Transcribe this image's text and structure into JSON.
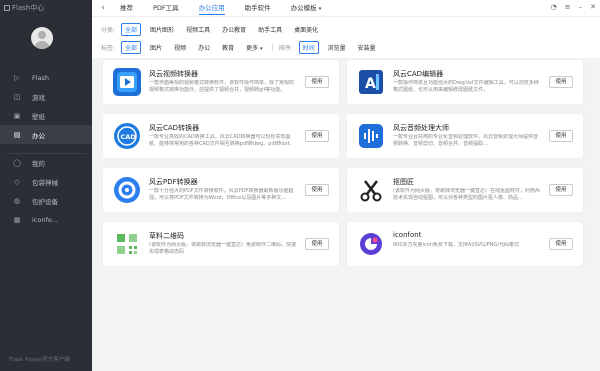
{
  "app": {
    "logo_text": "Flash中心",
    "footer": "Flash Player官方客户端"
  },
  "sidebar": {
    "items": [
      {
        "label": "Flash",
        "icon": "play-icon"
      },
      {
        "label": "游戏",
        "icon": "gamepad-icon"
      },
      {
        "label": "壁纸",
        "icon": "wallpaper-icon"
      },
      {
        "label": "办公",
        "icon": "briefcase-icon",
        "active": true
      },
      {
        "label": "我的",
        "icon": "user-icon"
      },
      {
        "label": "包袋神械",
        "icon": "shield-icon"
      },
      {
        "label": "包护设备",
        "icon": "device-icon"
      },
      {
        "label": "iconfo...",
        "icon": "grid-icon"
      }
    ]
  },
  "topbar": {
    "tabs": [
      "推荐",
      "PDF工具",
      "办公应用",
      "助手软件",
      "办公模板"
    ],
    "active_tab": "办公应用",
    "dropdown_tab": "办公模板"
  },
  "filters": {
    "row1_label": "分类:",
    "row1_items": [
      "全部",
      "图片图形",
      "视频工具",
      "办公教育",
      "助手工具",
      "桌面美化"
    ],
    "row2_label": "标签:",
    "row2_items": [
      "全部",
      "图片",
      "视频",
      "办公",
      "教育",
      "更多"
    ],
    "sort_label": "排序:",
    "sort_items": [
      "时间",
      "浏览量",
      "安装量"
    ]
  },
  "cards": [
    {
      "title": "风云视频转换器",
      "desc": "一款界面美观的视频格式转换软件，该软件操作简单，除了常规的视频格式转换功能外，还提供了视频合并，视频转gif等功能。",
      "button": "使用",
      "icon": "video-converter-icon"
    },
    {
      "title": "风云CAD编辑器",
      "desc": "一款操作简单且功能强大的Dwg/dxf文件编辑工具，可以浏览多种格式图纸，也可以用来编辑修改图纸文件。",
      "button": "使用",
      "icon": "cad-editor-icon"
    },
    {
      "title": "风云CAD转换器",
      "desc": "一款专业高效的CAD转换工具，风云CAD转换器可以轻松实现图纸、能够将常用的各种CAD文件相互转换pdf转dwg、pdf转dxf、cad转…",
      "button": "使用",
      "icon": "cad-converter-icon"
    },
    {
      "title": "风云音频处理大师",
      "desc": "一款专业且好用的专业化音频处理软件，风云音频处理大师提供音频转换、音频剪切、音频合并、音频提取…",
      "button": "使用",
      "icon": "audio-processor-icon"
    },
    {
      "title": "风云PDF转换器",
      "desc": "一款十分强大的PDF文件转换软件，风云PDF转换器最新版功能超强，可以将PDF文件转换为Word、Office以及图片等多种文…",
      "button": "使用",
      "icon": "pdf-converter-icon"
    },
    {
      "title": "抠图匠",
      "desc": "(该软件为网页版，将跳转浏览器一键直达）在线抠图软件，利用AI技术实现自动抠图，可以对各种类型的图片抠人像、商品…",
      "button": "使用",
      "icon": "cutout-icon"
    },
    {
      "title": "草料二维码",
      "desc": "(该软件为网页版，将跳转浏览器一键直达）免费制作二维码，快速实现表格动态码",
      "button": "使用",
      "icon": "qrcode-icon"
    },
    {
      "title": "iconfont",
      "desc": "800多万矢量icon免费下载，支持AI/SVG/PNG/代码格式",
      "button": "使用",
      "icon": "iconfont-icon"
    }
  ],
  "colors": {
    "accent": "#2d7ff0",
    "sidebar_bg": "#2b2e35"
  }
}
